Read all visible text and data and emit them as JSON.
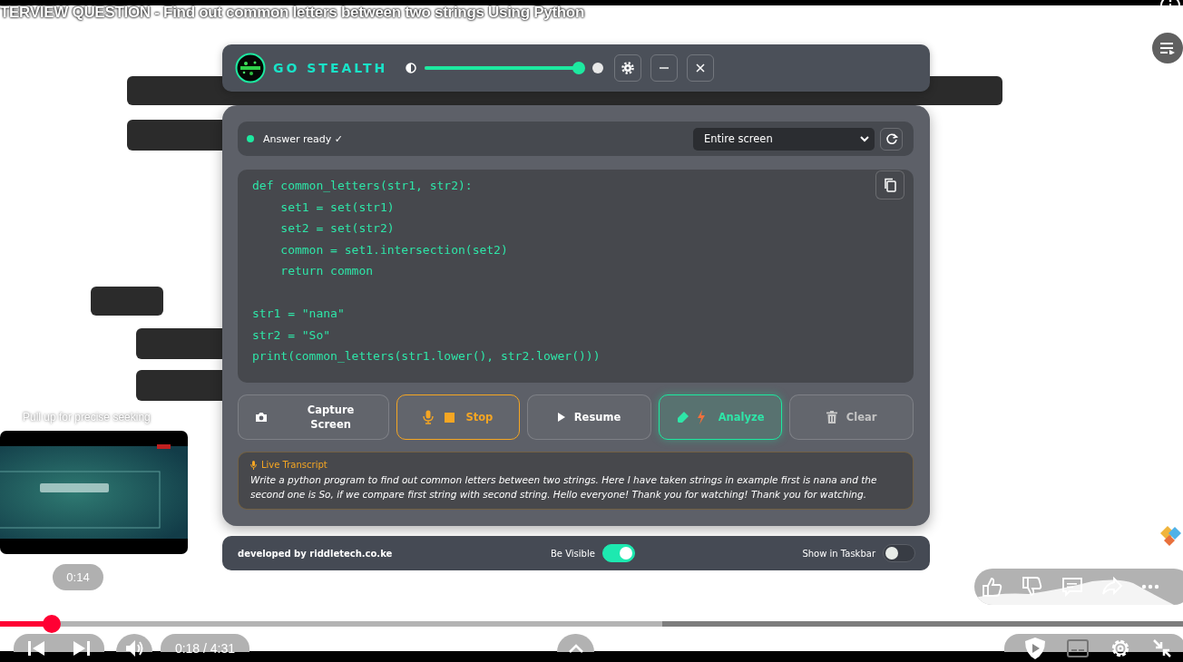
{
  "player": {
    "title": "TERVIEW QUESTION - Find out common letters between two strings Using Python",
    "seek_hint": "Pull up for precise seeking",
    "preview_time": "0:14",
    "progress": {
      "level": 0.044
    },
    "buffer": {
      "level": 0.56
    },
    "time": "0:18 / 4:31"
  },
  "app": {
    "header": {
      "title": "GO STEALTH",
      "opacity": {
        "level": 1
      }
    },
    "status": {
      "text": "Answer ready ✓",
      "ready": true
    },
    "source_select": {
      "value": "Entire screen"
    },
    "code": "def common_letters(str1, str2):\n    set1 = set(str1)\n    set2 = set(str2)\n    common = set1.intersection(set2)\n    return common\n\nstr1 = \"nana\"\nstr2 = \"So\"\nprint(common_letters(str1.lower(), str2.lower()))",
    "buttons": [
      {
        "label": "Capture Screen",
        "kind": "capture",
        "disabled": false
      },
      {
        "label": "Stop",
        "kind": "stop",
        "disabled": false
      },
      {
        "label": "Resume",
        "kind": "resume",
        "disabled": false
      },
      {
        "label": "Analyze",
        "kind": "analyze",
        "disabled": false
      },
      {
        "label": "Clear",
        "kind": "clear",
        "disabled": true
      }
    ],
    "transcript": {
      "title": "Live Transcript",
      "text": "Write a python program to find out common letters between two strings. Here I have taken strings in example first is nana and the second one is So, if we compare first string with second string. Hello everyone! Thank you for watching! Thank you for watching."
    },
    "footer": {
      "credit": "developed by riddletech.co.ke",
      "toggles": [
        {
          "label": "Be Visible",
          "on": true
        },
        {
          "label": "Show in Taskbar",
          "on": false
        }
      ]
    }
  }
}
